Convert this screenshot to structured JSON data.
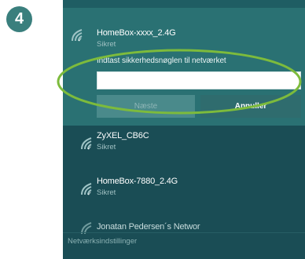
{
  "step": "4",
  "networks": [
    {
      "name": "HomeBox-xxxx_2.4G",
      "status": "Sikret"
    },
    {
      "name": "ZyXEL_CB6C",
      "status": "Sikret"
    },
    {
      "name": "HomeBox-7880_2.4G",
      "status": "Sikret"
    },
    {
      "name": "Jonatan Pedersen´s Networ",
      "status": ""
    }
  ],
  "key_prompt": "Indtast sikkerhedsnøglen til netværket",
  "key_input": {
    "value": "",
    "placeholder": ""
  },
  "buttons": {
    "next": "Næste",
    "cancel": "Annuller"
  },
  "footer": "Netværksindstillinger",
  "colors": {
    "panel": "#1a4d55",
    "active_row": "#2a7173",
    "highlight_ellipse": "#7dbb3c",
    "badge": "#3a7f7d"
  },
  "icons": {
    "network": "wifi-signal-icon"
  }
}
